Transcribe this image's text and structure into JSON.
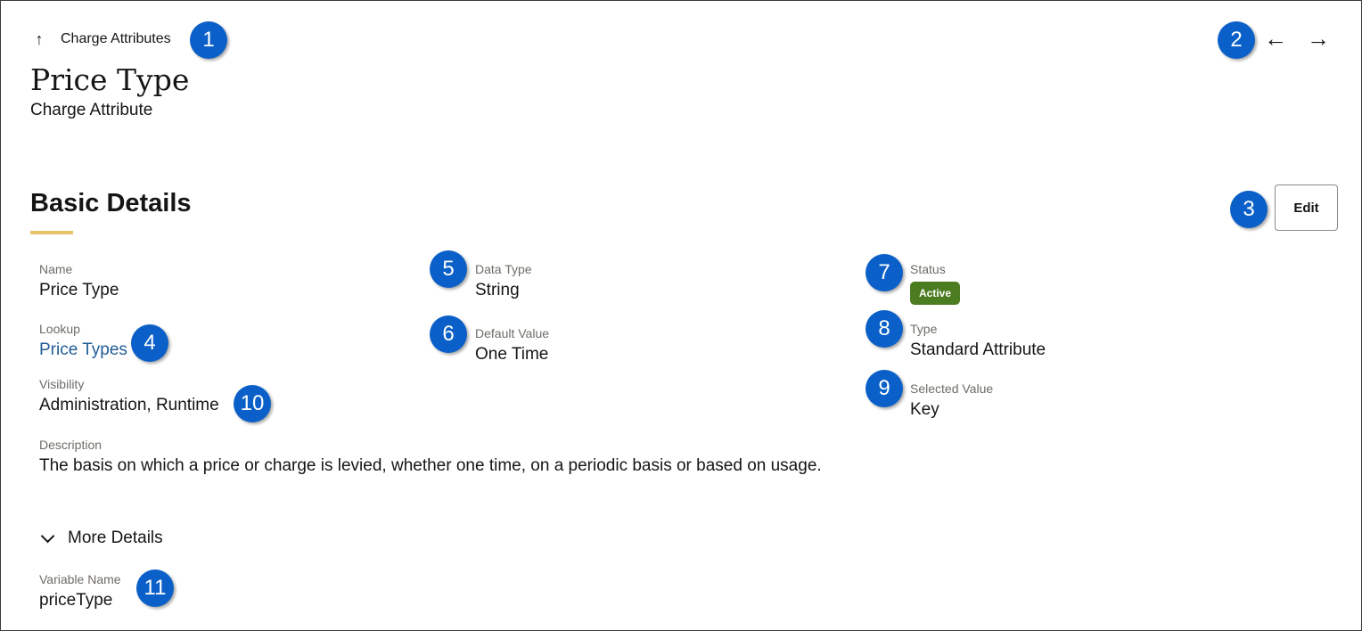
{
  "header": {
    "back_label": "Charge Attributes",
    "back_icon": "up-arrow-icon",
    "prev_icon": "left-arrow-icon",
    "next_icon": "right-arrow-icon",
    "title": "Price Type",
    "subtitle": "Charge Attribute"
  },
  "section": {
    "title": "Basic Details",
    "edit_label": "Edit",
    "accent_color": "#e8c468"
  },
  "fields": {
    "name": {
      "label": "Name",
      "value": "Price Type"
    },
    "lookup": {
      "label": "Lookup",
      "value": "Price Types"
    },
    "visibility": {
      "label": "Visibility",
      "value": "Administration, Runtime"
    },
    "description": {
      "label": "Description",
      "value": "The basis on which a price or charge is levied, whether one time, on a periodic basis or based on usage."
    },
    "data_type": {
      "label": "Data Type",
      "value": "String"
    },
    "default_value": {
      "label": "Default Value",
      "value": "One Time"
    },
    "status": {
      "label": "Status",
      "value": "Active",
      "color": "#4c7c20"
    },
    "type": {
      "label": "Type",
      "value": "Standard Attribute"
    },
    "selected_value": {
      "label": "Selected Value",
      "value": "Key"
    }
  },
  "more_details": {
    "toggle_label": "More Details",
    "toggle_icon": "chevron-down-icon",
    "variable_name": {
      "label": "Variable Name",
      "value": "priceType"
    }
  },
  "callouts": [
    "1",
    "2",
    "3",
    "4",
    "5",
    "6",
    "7",
    "8",
    "9",
    "10",
    "11"
  ],
  "colors": {
    "callout": "#0a60c8",
    "link": "#215e96"
  }
}
